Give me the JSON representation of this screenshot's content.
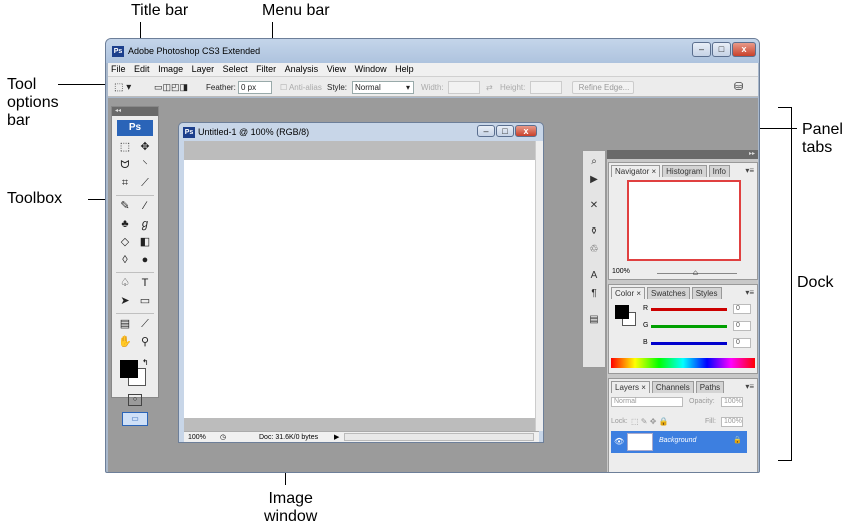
{
  "callouts": {
    "title_bar": "Title bar",
    "menu_bar": "Menu bar",
    "tool_options_bar": [
      "Tool",
      "options",
      "bar"
    ],
    "toolbox": "Toolbox",
    "panel_tabs": [
      "Panel",
      "tabs"
    ],
    "dock": "Dock",
    "image_window": [
      "Image",
      "window"
    ]
  },
  "app": {
    "title": "Adobe Photoshop CS3 Extended",
    "icon_label": "Ps"
  },
  "menu": [
    "File",
    "Edit",
    "Image",
    "Layer",
    "Select",
    "Filter",
    "Analysis",
    "View",
    "Window",
    "Help"
  ],
  "options_bar": {
    "feather_label": "Feather:",
    "feather_value": "0 px",
    "antialias_label": "Anti-alias",
    "style_label": "Style:",
    "style_value": "Normal",
    "width_label": "Width:",
    "height_label": "Height:",
    "refine_edge": "Refine Edge..."
  },
  "toolbox": {
    "logo": "Ps"
  },
  "document": {
    "title": "Untitled-1 @ 100% (RGB/8)",
    "zoom": "100%",
    "doc_info": "Doc: 31.6K/0 bytes"
  },
  "navigator_panel": {
    "tabs": [
      "Navigator ×",
      "Histogram",
      "Info"
    ],
    "zoom": "100%"
  },
  "color_panel": {
    "tabs": [
      "Color ×",
      "Swatches",
      "Styles"
    ],
    "channels": [
      {
        "label": "R",
        "value": "0",
        "color": "#cc0000"
      },
      {
        "label": "G",
        "value": "0",
        "color": "#00a000"
      },
      {
        "label": "B",
        "value": "0",
        "color": "#0000cc"
      }
    ]
  },
  "layers_panel": {
    "tabs": [
      "Layers ×",
      "Channels",
      "Paths"
    ],
    "blend_mode": "Normal",
    "opacity_label": "Opacity:",
    "opacity_value": "100%",
    "lock_label": "Lock:",
    "fill_label": "Fill:",
    "fill_value": "100%",
    "layer_name": "Background"
  },
  "colors": {
    "accent": "#2a64b8",
    "selected_layer": "#3d7fe0"
  }
}
